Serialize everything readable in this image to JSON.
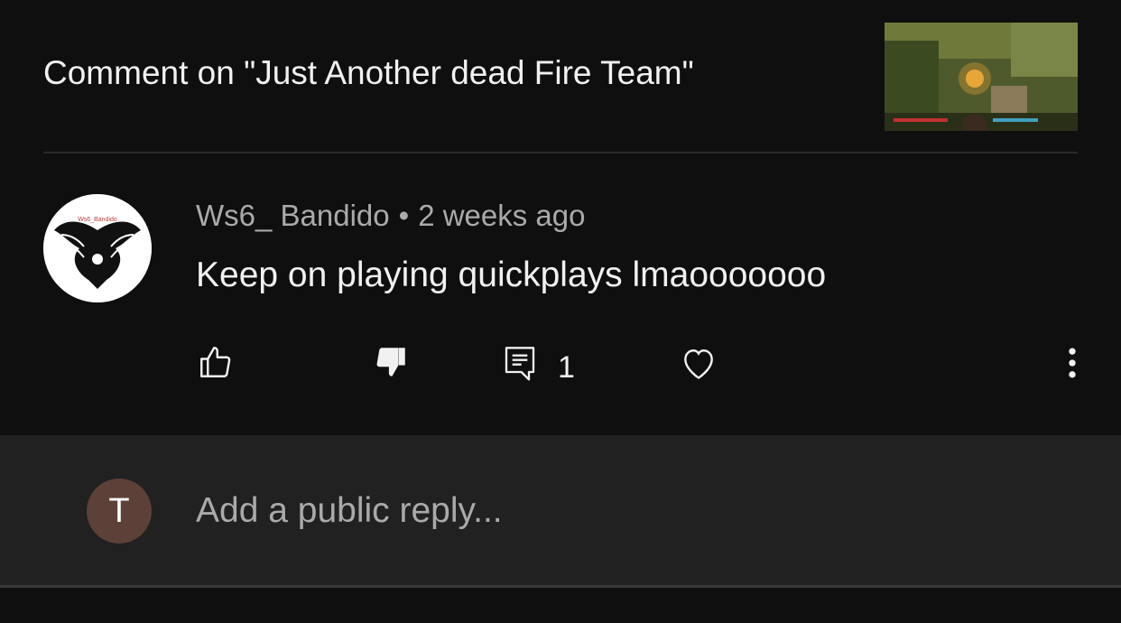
{
  "header": {
    "title": "Comment on \"Just Another dead Fire Team\"",
    "thumbnail_icon": "video-thumbnail"
  },
  "comment": {
    "author": "Ws6_ Bandido",
    "separator": "•",
    "time": "2 weeks ago",
    "text": "Keep on playing quickplays lmaooooooo",
    "avatar_text": "Ws6_Bandido",
    "reply_count": "1",
    "icons": {
      "like": "thumbs-up-icon",
      "dislike": "thumbs-down-icon",
      "reply": "comment-icon",
      "heart": "heart-icon",
      "more": "more-vertical-icon"
    }
  },
  "reply": {
    "avatar_letter": "T",
    "placeholder": "Add a public reply...",
    "avatar_color": "#5d4037"
  }
}
